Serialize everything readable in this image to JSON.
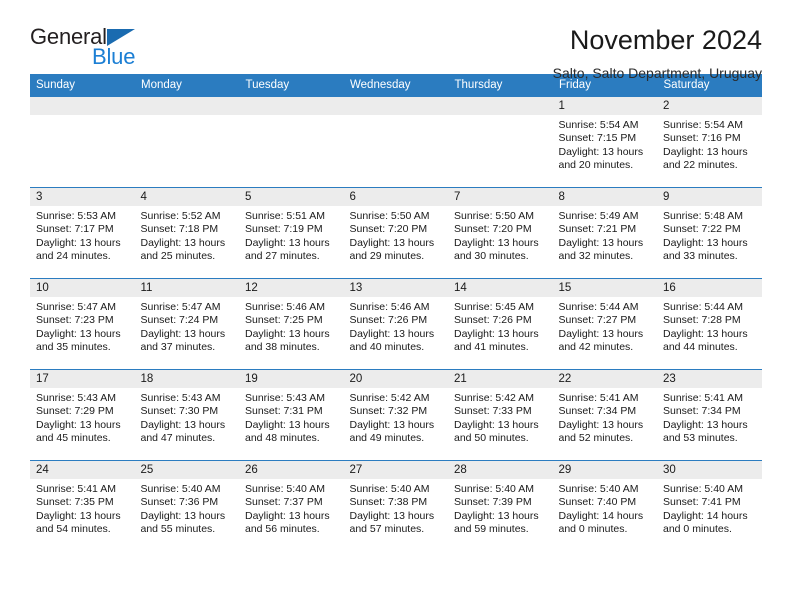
{
  "brand": {
    "name_part1": "General",
    "name_part2": "Blue",
    "triangle_color": "#1a6bb0",
    "blue_color": "#1c7fd4"
  },
  "header": {
    "title": "November 2024",
    "subtitle": "Salto, Salto Department, Uruguay"
  },
  "theme": {
    "header_bg": "#2b7cc0",
    "daynum_bg": "#ececec",
    "cell_bg": "#ffffff",
    "text": "#1a1a1a"
  },
  "weekday_headers": [
    "Sunday",
    "Monday",
    "Tuesday",
    "Wednesday",
    "Thursday",
    "Friday",
    "Saturday"
  ],
  "weeks": [
    [
      {
        "day": "",
        "empty": true
      },
      {
        "day": "",
        "empty": true
      },
      {
        "day": "",
        "empty": true
      },
      {
        "day": "",
        "empty": true
      },
      {
        "day": "",
        "empty": true
      },
      {
        "day": "1",
        "sunrise": "Sunrise: 5:54 AM",
        "sunset": "Sunset: 7:15 PM",
        "daylight": "Daylight: 13 hours and 20 minutes."
      },
      {
        "day": "2",
        "sunrise": "Sunrise: 5:54 AM",
        "sunset": "Sunset: 7:16 PM",
        "daylight": "Daylight: 13 hours and 22 minutes."
      }
    ],
    [
      {
        "day": "3",
        "sunrise": "Sunrise: 5:53 AM",
        "sunset": "Sunset: 7:17 PM",
        "daylight": "Daylight: 13 hours and 24 minutes."
      },
      {
        "day": "4",
        "sunrise": "Sunrise: 5:52 AM",
        "sunset": "Sunset: 7:18 PM",
        "daylight": "Daylight: 13 hours and 25 minutes."
      },
      {
        "day": "5",
        "sunrise": "Sunrise: 5:51 AM",
        "sunset": "Sunset: 7:19 PM",
        "daylight": "Daylight: 13 hours and 27 minutes."
      },
      {
        "day": "6",
        "sunrise": "Sunrise: 5:50 AM",
        "sunset": "Sunset: 7:20 PM",
        "daylight": "Daylight: 13 hours and 29 minutes."
      },
      {
        "day": "7",
        "sunrise": "Sunrise: 5:50 AM",
        "sunset": "Sunset: 7:20 PM",
        "daylight": "Daylight: 13 hours and 30 minutes."
      },
      {
        "day": "8",
        "sunrise": "Sunrise: 5:49 AM",
        "sunset": "Sunset: 7:21 PM",
        "daylight": "Daylight: 13 hours and 32 minutes."
      },
      {
        "day": "9",
        "sunrise": "Sunrise: 5:48 AM",
        "sunset": "Sunset: 7:22 PM",
        "daylight": "Daylight: 13 hours and 33 minutes."
      }
    ],
    [
      {
        "day": "10",
        "sunrise": "Sunrise: 5:47 AM",
        "sunset": "Sunset: 7:23 PM",
        "daylight": "Daylight: 13 hours and 35 minutes."
      },
      {
        "day": "11",
        "sunrise": "Sunrise: 5:47 AM",
        "sunset": "Sunset: 7:24 PM",
        "daylight": "Daylight: 13 hours and 37 minutes."
      },
      {
        "day": "12",
        "sunrise": "Sunrise: 5:46 AM",
        "sunset": "Sunset: 7:25 PM",
        "daylight": "Daylight: 13 hours and 38 minutes."
      },
      {
        "day": "13",
        "sunrise": "Sunrise: 5:46 AM",
        "sunset": "Sunset: 7:26 PM",
        "daylight": "Daylight: 13 hours and 40 minutes."
      },
      {
        "day": "14",
        "sunrise": "Sunrise: 5:45 AM",
        "sunset": "Sunset: 7:26 PM",
        "daylight": "Daylight: 13 hours and 41 minutes."
      },
      {
        "day": "15",
        "sunrise": "Sunrise: 5:44 AM",
        "sunset": "Sunset: 7:27 PM",
        "daylight": "Daylight: 13 hours and 42 minutes."
      },
      {
        "day": "16",
        "sunrise": "Sunrise: 5:44 AM",
        "sunset": "Sunset: 7:28 PM",
        "daylight": "Daylight: 13 hours and 44 minutes."
      }
    ],
    [
      {
        "day": "17",
        "sunrise": "Sunrise: 5:43 AM",
        "sunset": "Sunset: 7:29 PM",
        "daylight": "Daylight: 13 hours and 45 minutes."
      },
      {
        "day": "18",
        "sunrise": "Sunrise: 5:43 AM",
        "sunset": "Sunset: 7:30 PM",
        "daylight": "Daylight: 13 hours and 47 minutes."
      },
      {
        "day": "19",
        "sunrise": "Sunrise: 5:43 AM",
        "sunset": "Sunset: 7:31 PM",
        "daylight": "Daylight: 13 hours and 48 minutes."
      },
      {
        "day": "20",
        "sunrise": "Sunrise: 5:42 AM",
        "sunset": "Sunset: 7:32 PM",
        "daylight": "Daylight: 13 hours and 49 minutes."
      },
      {
        "day": "21",
        "sunrise": "Sunrise: 5:42 AM",
        "sunset": "Sunset: 7:33 PM",
        "daylight": "Daylight: 13 hours and 50 minutes."
      },
      {
        "day": "22",
        "sunrise": "Sunrise: 5:41 AM",
        "sunset": "Sunset: 7:34 PM",
        "daylight": "Daylight: 13 hours and 52 minutes."
      },
      {
        "day": "23",
        "sunrise": "Sunrise: 5:41 AM",
        "sunset": "Sunset: 7:34 PM",
        "daylight": "Daylight: 13 hours and 53 minutes."
      }
    ],
    [
      {
        "day": "24",
        "sunrise": "Sunrise: 5:41 AM",
        "sunset": "Sunset: 7:35 PM",
        "daylight": "Daylight: 13 hours and 54 minutes."
      },
      {
        "day": "25",
        "sunrise": "Sunrise: 5:40 AM",
        "sunset": "Sunset: 7:36 PM",
        "daylight": "Daylight: 13 hours and 55 minutes."
      },
      {
        "day": "26",
        "sunrise": "Sunrise: 5:40 AM",
        "sunset": "Sunset: 7:37 PM",
        "daylight": "Daylight: 13 hours and 56 minutes."
      },
      {
        "day": "27",
        "sunrise": "Sunrise: 5:40 AM",
        "sunset": "Sunset: 7:38 PM",
        "daylight": "Daylight: 13 hours and 57 minutes."
      },
      {
        "day": "28",
        "sunrise": "Sunrise: 5:40 AM",
        "sunset": "Sunset: 7:39 PM",
        "daylight": "Daylight: 13 hours and 59 minutes."
      },
      {
        "day": "29",
        "sunrise": "Sunrise: 5:40 AM",
        "sunset": "Sunset: 7:40 PM",
        "daylight": "Daylight: 14 hours and 0 minutes."
      },
      {
        "day": "30",
        "sunrise": "Sunrise: 5:40 AM",
        "sunset": "Sunset: 7:41 PM",
        "daylight": "Daylight: 14 hours and 0 minutes."
      }
    ]
  ]
}
